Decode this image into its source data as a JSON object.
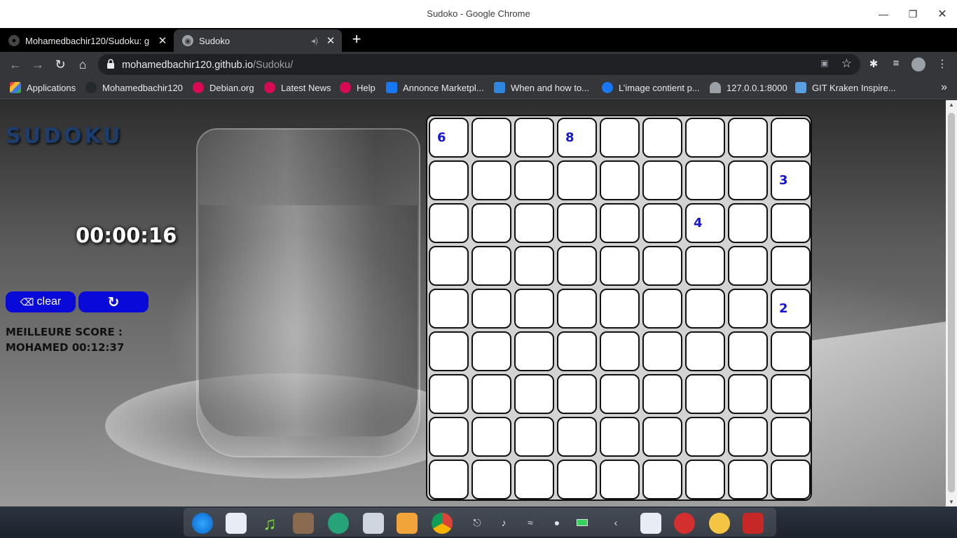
{
  "window": {
    "title": "Sudoko - Google Chrome"
  },
  "tabs": [
    {
      "label": "Mohamedbachir120/Sudoku: g",
      "active": false
    },
    {
      "label": "Sudoko",
      "active": true
    }
  ],
  "address": {
    "host": "mohamedbachir120.github.io",
    "path": "/Sudoku/"
  },
  "bookmarks": [
    {
      "label": "Applications",
      "color": "#e8453c"
    },
    {
      "label": "Mohamedbachir120",
      "color": "#24292e"
    },
    {
      "label": "Debian.org",
      "color": "#d70a53"
    },
    {
      "label": "Latest News",
      "color": "#d70a53"
    },
    {
      "label": "Help",
      "color": "#d70a53"
    },
    {
      "label": "Annonce Marketpl...",
      "color": "#1877f2"
    },
    {
      "label": "When and how to...",
      "color": "#2e86de"
    },
    {
      "label": "L’image contient p...",
      "color": "#1877f2"
    },
    {
      "label": "127.0.0.1:8000",
      "color": "#9aa0a6"
    },
    {
      "label": "GIT Kraken Inspire...",
      "color": "#5aa0e0"
    }
  ],
  "game": {
    "logo": "SUDOKU",
    "timer": "00:00:16",
    "clear_label": "clear",
    "best_score_label": "MEILLEURE SCORE :",
    "best_score_value": "MOHAMED 00:12:37",
    "accent_color": "#0a0ad8"
  },
  "board": [
    [
      "6",
      "",
      "",
      "8",
      "",
      "",
      "",
      "",
      ""
    ],
    [
      "",
      "",
      "",
      "",
      "",
      "",
      "",
      "",
      "3"
    ],
    [
      "",
      "",
      "",
      "",
      "",
      "",
      "4",
      "",
      ""
    ],
    [
      "",
      "",
      "",
      "",
      "",
      "",
      "",
      "",
      ""
    ],
    [
      "",
      "",
      "",
      "",
      "",
      "",
      "",
      "",
      "2"
    ],
    [
      "",
      "",
      "",
      "",
      "",
      "",
      "",
      "",
      ""
    ],
    [
      "",
      "",
      "",
      "",
      "",
      "",
      "",
      "",
      ""
    ],
    [
      "",
      "",
      "",
      "",
      "",
      "",
      "",
      "",
      ""
    ],
    [
      "",
      "",
      "",
      "",
      "",
      "",
      "",
      "",
      ""
    ]
  ],
  "taskbar": {
    "apps": [
      "deepin-launcher-icon",
      "app-store-icon",
      "music-icon",
      "video-icon",
      "settings-icon",
      "file-manager-icon",
      "sublime-text-icon",
      "chrome-icon"
    ],
    "tray": [
      "usb-icon",
      "volume-icon",
      "wifi-icon",
      "notification-icon",
      "battery-icon",
      "collapse-icon",
      "keyboard-icon",
      "power-icon",
      "clock-icon",
      "trash-icon"
    ]
  }
}
